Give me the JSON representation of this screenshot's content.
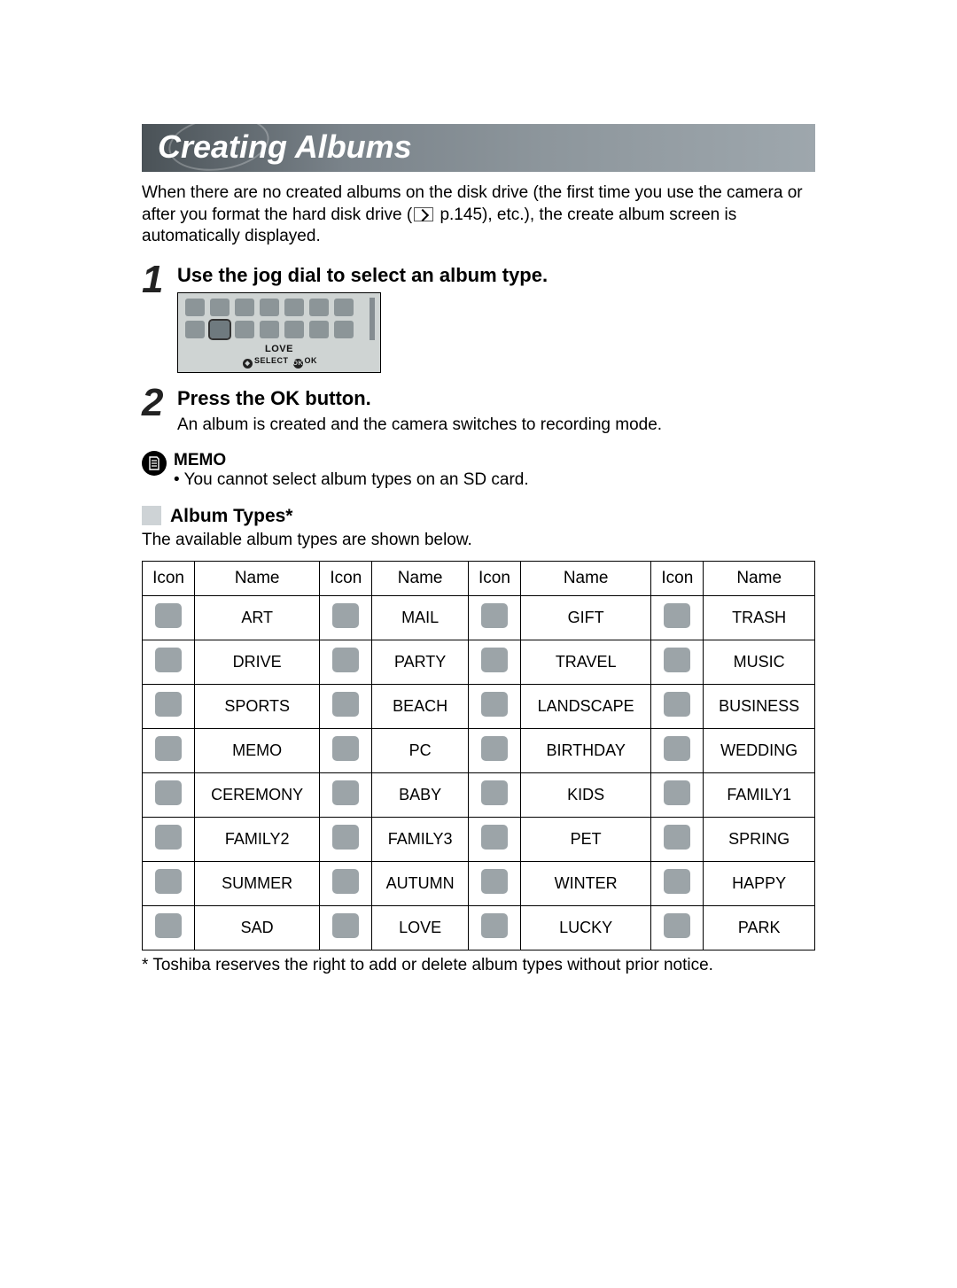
{
  "title": "Creating Albums",
  "intro_prefix": "When there are no created albums on the disk drive (the first time you use the camera or after you format the hard disk drive (",
  "intro_pageref": " p.145), etc.), the create album screen is automatically displayed.",
  "steps": [
    {
      "num": "1",
      "title": "Use the jog dial to select an album type.",
      "lcd_label": "LOVE",
      "lcd_select": "SELECT",
      "lcd_ok_badge": "OK",
      "lcd_ok": "OK"
    },
    {
      "num": "2",
      "title": "Press the OK button.",
      "text": "An album is created and the camera switches to recording mode."
    }
  ],
  "memo": {
    "label": "MEMO",
    "bullet": "• You cannot select album types on an SD card."
  },
  "album_types_section": {
    "title": "Album Types*",
    "intro": "The available album types are shown below.",
    "headers": [
      "Icon",
      "Name",
      "Icon",
      "Name",
      "Icon",
      "Name",
      "Icon",
      "Name"
    ],
    "rows": [
      [
        "ART",
        "MAIL",
        "GIFT",
        "TRASH"
      ],
      [
        "DRIVE",
        "PARTY",
        "TRAVEL",
        "MUSIC"
      ],
      [
        "SPORTS",
        "BEACH",
        "LANDSCAPE",
        "BUSINESS"
      ],
      [
        "MEMO",
        "PC",
        "BIRTHDAY",
        "WEDDING"
      ],
      [
        "CEREMONY",
        "BABY",
        "KIDS",
        "FAMILY1"
      ],
      [
        "FAMILY2",
        "FAMILY3",
        "PET",
        "SPRING"
      ],
      [
        "SUMMER",
        "AUTUMN",
        "WINTER",
        "HAPPY"
      ],
      [
        "SAD",
        "LOVE",
        "LUCKY",
        "PARK"
      ]
    ],
    "footnote": "* Toshiba reserves the right to add or delete album types without prior notice."
  }
}
